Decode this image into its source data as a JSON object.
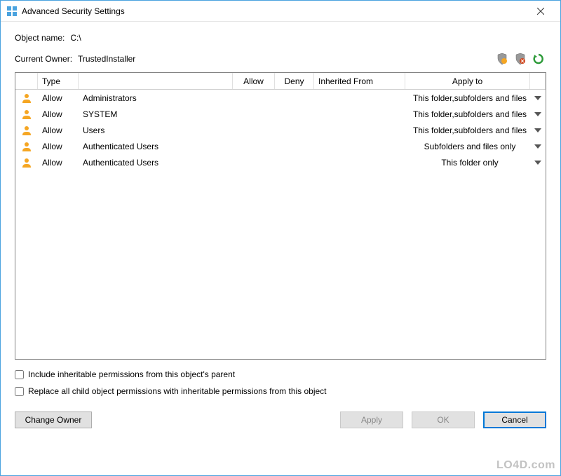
{
  "window": {
    "title": "Advanced Security Settings"
  },
  "object": {
    "label": "Object name:",
    "value": "C:\\"
  },
  "owner": {
    "label": "Current Owner:",
    "value": "TrustedInstaller"
  },
  "columns": {
    "type": "Type",
    "allow": "Allow",
    "deny": "Deny",
    "inherited": "Inherited From",
    "apply": "Apply to"
  },
  "rows": [
    {
      "type": "Allow",
      "name": "Administrators",
      "allow": "",
      "deny": "",
      "inherited": "",
      "apply": "This folder,subfolders and files"
    },
    {
      "type": "Allow",
      "name": "SYSTEM",
      "allow": "",
      "deny": "",
      "inherited": "",
      "apply": "This folder,subfolders and files"
    },
    {
      "type": "Allow",
      "name": "Users",
      "allow": "",
      "deny": "",
      "inherited": "",
      "apply": "This folder,subfolders and files"
    },
    {
      "type": "Allow",
      "name": "Authenticated Users",
      "allow": "",
      "deny": "",
      "inherited": "",
      "apply": "Subfolders and files only"
    },
    {
      "type": "Allow",
      "name": "Authenticated Users",
      "allow": "",
      "deny": "",
      "inherited": "",
      "apply": "This folder only"
    }
  ],
  "checkboxes": {
    "inherit": "Include inheritable permissions from this object's parent",
    "replace": "Replace all child object permissions with inheritable permissions from this object"
  },
  "buttons": {
    "change_owner": "Change Owner",
    "apply": "Apply",
    "ok": "OK",
    "cancel": "Cancel"
  },
  "watermark": "LO4D.com"
}
